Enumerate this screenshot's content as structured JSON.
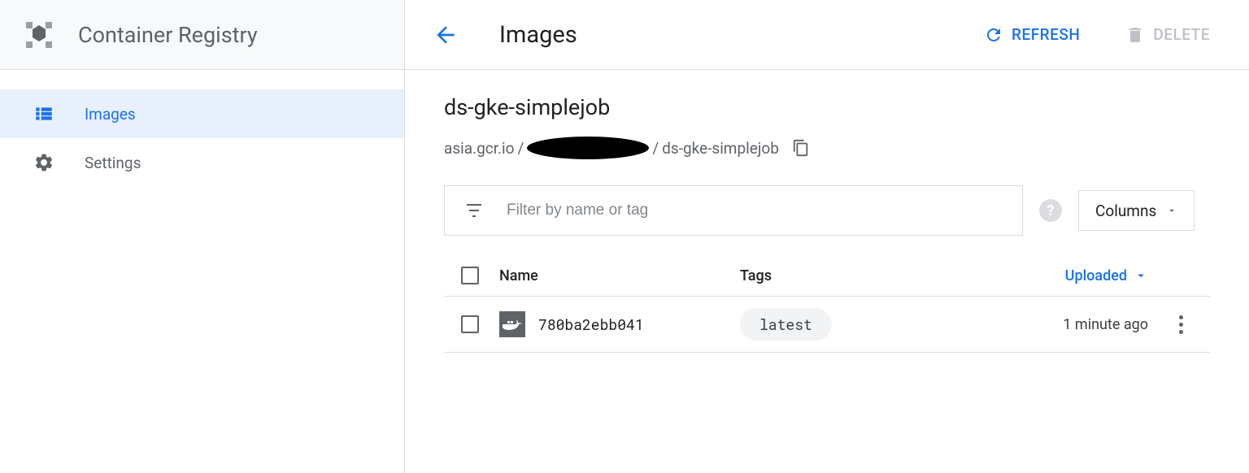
{
  "product": {
    "name": "Container Registry"
  },
  "sidebar": {
    "items": [
      {
        "label": "Images",
        "icon": "list-icon",
        "active": true
      },
      {
        "label": "Settings",
        "icon": "gear-icon",
        "active": false
      }
    ]
  },
  "toolbar": {
    "page_title": "Images",
    "refresh_label": "REFRESH",
    "delete_label": "DELETE"
  },
  "repo": {
    "name": "ds-gke-simplejob",
    "breadcrumb_host": "asia.gcr.io",
    "breadcrumb_sep": " / ",
    "breadcrumb_project": "[redacted]",
    "breadcrumb_repo": "ds-gke-simplejob"
  },
  "filter": {
    "placeholder": "Filter by name or tag",
    "columns_label": "Columns"
  },
  "table": {
    "headers": {
      "name": "Name",
      "tags": "Tags",
      "uploaded": "Uploaded"
    },
    "rows": [
      {
        "name": "780ba2ebb041",
        "tags": [
          "latest"
        ],
        "uploaded": "1 minute ago"
      }
    ]
  }
}
